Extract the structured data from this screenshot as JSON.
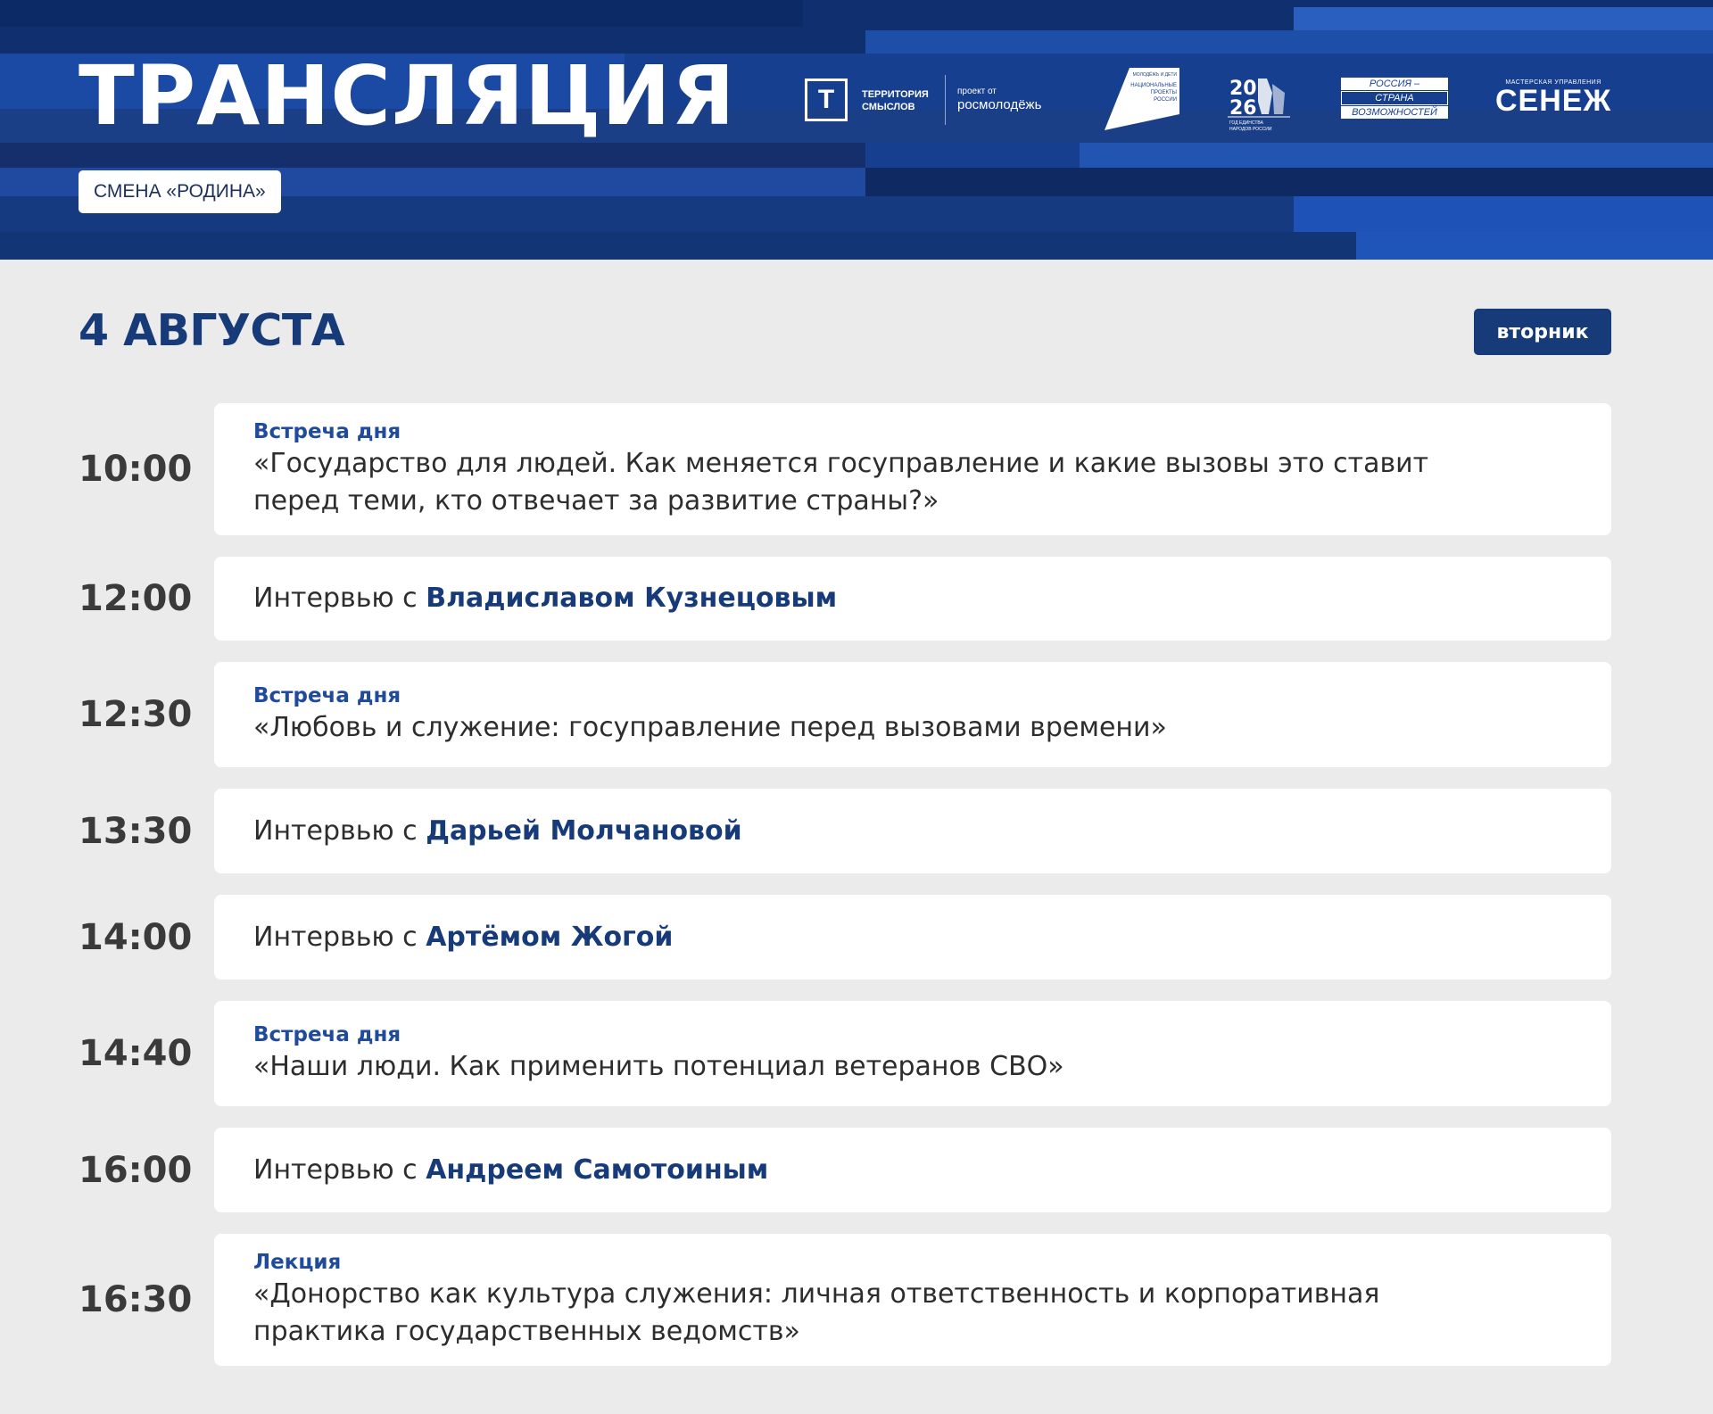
{
  "header": {
    "title": "ТРАНСЛЯЦИЯ",
    "shift_badge": "СМЕНА «РОДИНА»",
    "logos": {
      "territory": {
        "letter": "Т",
        "name_line1": "ТЕРРИТОРИЯ",
        "name_line2": "СМЫСЛОВ"
      },
      "rosmolodezh": {
        "caption": "проект от",
        "name": "росмолодёжь"
      },
      "national_projects": {
        "line1": "МОЛОДЁЖЬ И ДЕТИ",
        "line2": "НАЦИОНАЛЬНЫЕ",
        "line3": "ПРОЕКТЫ",
        "line4": "РОССИИ"
      },
      "year_unity": {
        "top": "20",
        "bottom": "26",
        "caption1": "ГОД ЕДИНСТВА",
        "caption2": "НАРОДОВ РОССИИ"
      },
      "russia_opportunities": {
        "line1": "РОССИЯ –",
        "line2": "СТРАНА",
        "line3": "ВОЗМОЖНОСТЕЙ"
      },
      "senezh": {
        "caption": "МАСТЕРСКАЯ УПРАВЛЕНИЯ",
        "name": "СЕНЕЖ"
      }
    }
  },
  "date": {
    "heading": "4 АВГУСТА",
    "weekday": "вторник"
  },
  "schedule": [
    {
      "time": "10:00",
      "label": "Встреча дня",
      "text": "«Государство для людей. Как меняется госуправление и какие вызовы это ставит\nперед теми, кто отвечает за развитие страны?»",
      "prefix": "",
      "name": ""
    },
    {
      "time": "12:00",
      "label": "",
      "text": "",
      "prefix": "Интервью с ",
      "name": "Владиславом Кузнецовым"
    },
    {
      "time": "12:30",
      "label": "Встреча дня",
      "text": " «Любовь и служение: госуправление перед вызовами времени»",
      "prefix": "",
      "name": ""
    },
    {
      "time": "13:30",
      "label": "",
      "text": "",
      "prefix": "Интервью с ",
      "name": "Дарьей Молчановой"
    },
    {
      "time": "14:00",
      "label": "",
      "text": "",
      "prefix": "Интервью с ",
      "name": "Артёмом Жогой"
    },
    {
      "time": "14:40",
      "label": "Встреча дня",
      "text": " «Наши люди. Как применить потенциал ветеранов СВО»",
      "prefix": "",
      "name": ""
    },
    {
      "time": "16:00",
      "label": "",
      "text": "",
      "prefix": "Интервью с ",
      "name": "Андреем Самотоиным"
    },
    {
      "time": "16:30",
      "label": "Лекция",
      "text": "«Донорство как культура служения: личная ответственность и корпоративная\nпрактика государственных ведомств»",
      "prefix": "",
      "name": ""
    }
  ],
  "colors": {
    "header_bg": "#173f8f",
    "accent_dark_blue": "#173a78",
    "label_blue": "#1f4b9a",
    "page_bg": "#ebebeb"
  }
}
